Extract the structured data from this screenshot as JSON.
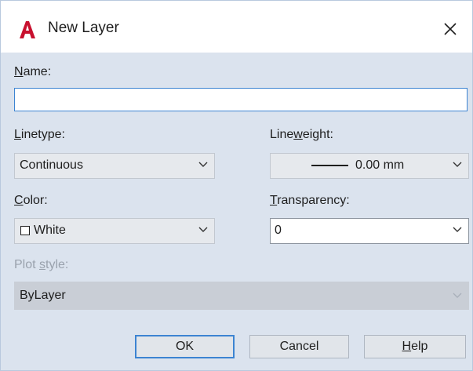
{
  "dialog": {
    "title": "New Layer",
    "app_icon": "autocad-a-icon",
    "close_icon": "close-icon"
  },
  "name": {
    "label": "Name:",
    "label_accel": "N",
    "label_rest": "ame:",
    "value": ""
  },
  "linetype": {
    "label": "Linetype:",
    "label_accel": "L",
    "label_rest": "inetype:",
    "value": "Continuous"
  },
  "lineweight": {
    "label": "Lineweight:",
    "label_pre": "Line",
    "label_accel": "w",
    "label_rest": "eight:",
    "value": "0.00 mm"
  },
  "color": {
    "label": "Color:",
    "label_accel": "C",
    "label_rest": "olor:",
    "value": "White",
    "swatch": "#ffffff"
  },
  "transparency": {
    "label": "Transparency:",
    "label_accel": "T",
    "label_rest": "ransparency:",
    "value": "0"
  },
  "plot_style": {
    "label": "Plot style:",
    "label_pre": "Plot ",
    "label_accel": "s",
    "label_rest": "tyle:",
    "value": "ByLayer",
    "enabled": false
  },
  "buttons": {
    "ok": "OK",
    "cancel": "Cancel",
    "help": "Help",
    "help_accel": "H",
    "help_rest": "elp"
  },
  "colors": {
    "accent": "#3c84d2",
    "dialog_bg": "#dbe3ee",
    "brand_red": "#c8102e"
  }
}
